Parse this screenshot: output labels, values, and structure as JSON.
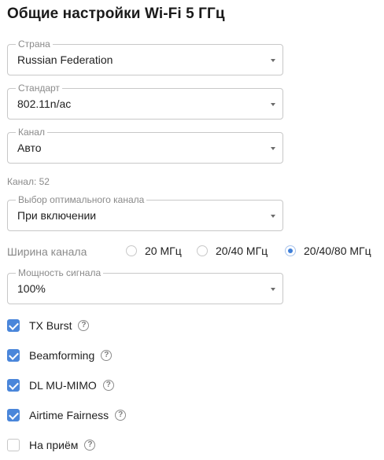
{
  "title": "Общие настройки Wi-Fi 5 ГГц",
  "fields": {
    "country": {
      "label": "Страна",
      "value": "Russian Federation"
    },
    "standard": {
      "label": "Стандарт",
      "value": "802.11n/ac"
    },
    "channel": {
      "label": "Канал",
      "value": "Авто"
    },
    "optimal_channel": {
      "label": "Выбор оптимального канала",
      "value": "При включении"
    },
    "signal_power": {
      "label": "Мощность сигнала",
      "value": "100%"
    }
  },
  "channel_note": "Канал: 52",
  "channel_width": {
    "label": "Ширина канала",
    "options": [
      "20 МГц",
      "20/40 МГц",
      "20/40/80 МГц"
    ],
    "selected": "20/40/80 МГц"
  },
  "checkboxes": [
    {
      "label": "TX Burst",
      "checked": true
    },
    {
      "label": "Beamforming",
      "checked": true
    },
    {
      "label": "DL MU-MIMO",
      "checked": true
    },
    {
      "label": "Airtime Fairness",
      "checked": true
    },
    {
      "label": "На приём",
      "checked": false
    }
  ],
  "help_glyph": "?",
  "colors": {
    "accent": "#4a86da",
    "border": "#c8c8c8",
    "muted": "#8a8a8a"
  }
}
